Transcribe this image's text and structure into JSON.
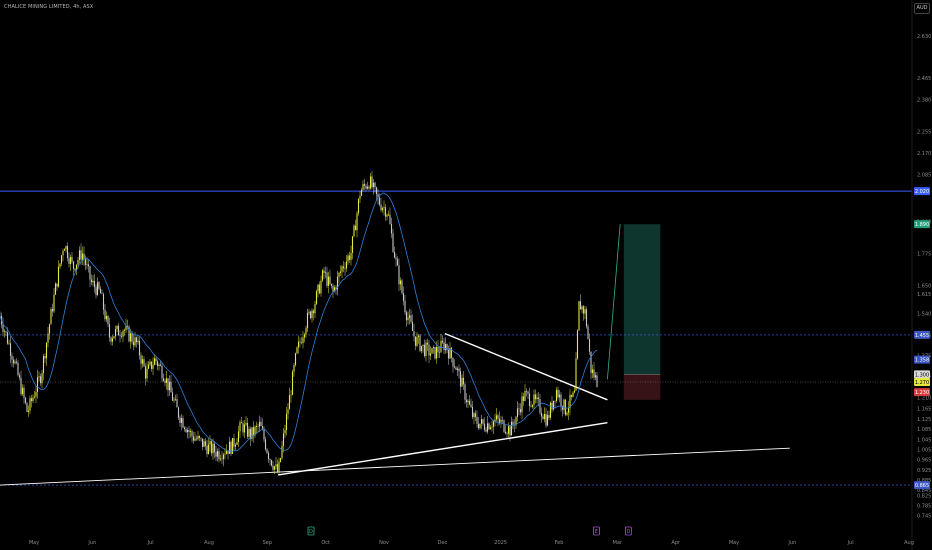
{
  "header": {
    "symbol_title": "CHALICE MINING LIMITED, 4h, ASX",
    "currency": "AUD"
  },
  "colors": {
    "background": "#000000",
    "candle_up": "#e6e83a",
    "candle_down": "#c9c9c9",
    "moving_average": "#2f7fd8",
    "resistance_line": "#3a5cff",
    "trendline": "#ffffff",
    "dashed_level": "#3b57c7",
    "target_zone": "#0f3c34",
    "stop_zone": "#3a1417",
    "projection": "#2db28a"
  },
  "chart_data": {
    "type": "candlestick",
    "price_axis": {
      "ylim": [
        0.72,
        2.7
      ],
      "ticks": [
        "2.630",
        "2.465",
        "2.380",
        "2.255",
        "2.170",
        "2.085",
        "1.900",
        "1.775",
        "1.650",
        "1.615",
        "1.540",
        "1.455",
        "1.375",
        "1.295",
        "1.210",
        "1.165",
        "1.125",
        "1.085",
        "1.045",
        "1.005",
        "0.965",
        "0.925",
        "0.885",
        "0.845",
        "0.825",
        "0.785",
        "0.745"
      ]
    },
    "time_axis": {
      "ticks": [
        "May",
        "Jun",
        "Jul",
        "Aug",
        "Sep",
        "Oct",
        "Nov",
        "Dec",
        "2025",
        "Feb",
        "Mar",
        "Apr",
        "May",
        "Jun",
        "Jul",
        "Aug"
      ]
    },
    "price_labels": [
      {
        "text": "2.020",
        "value": 2.02,
        "color": "#3a5cff"
      },
      {
        "text": "1.890",
        "value": 1.89,
        "color": "#1f9e7a"
      },
      {
        "text": "1.455",
        "value": 1.455,
        "color": "#3b57c7"
      },
      {
        "text": "1.358",
        "value": 1.358,
        "color": "#3b57c7"
      },
      {
        "text": "1.300",
        "value": 1.3,
        "color": "#d9d9d9"
      },
      {
        "text": "1.270",
        "value": 1.27,
        "color": "#e6e83a"
      },
      {
        "text": "1.230",
        "value": 1.23,
        "color": "#d9393c"
      },
      {
        "text": "0.865",
        "value": 0.865,
        "color": "#3b57c7"
      }
    ],
    "horizontal_levels": [
      {
        "name": "resistance",
        "value": 2.02,
        "style": "solid"
      },
      {
        "name": "upper-dashed",
        "value": 1.455,
        "style": "dashed"
      },
      {
        "name": "lower-dashed",
        "value": 0.865,
        "style": "dashed"
      },
      {
        "name": "current-price",
        "value": 1.27,
        "style": "dotted"
      }
    ],
    "trendlines": [
      {
        "name": "triangle-upper",
        "x": [
          0.488,
          0.666
        ],
        "y": [
          1.46,
          1.2
        ]
      },
      {
        "name": "triangle-lower",
        "x": [
          0.305,
          0.666
        ],
        "y": [
          0.905,
          1.11
        ]
      },
      {
        "name": "long-support",
        "x": [
          0.0,
          0.866
        ],
        "y": [
          0.865,
          1.01
        ]
      }
    ],
    "position_tool": {
      "x_start": 0.684,
      "x_end": 0.724,
      "entry": 1.3,
      "target": 1.89,
      "stop": 1.2
    },
    "projection": {
      "x": [
        0.666,
        0.68
      ],
      "y": [
        1.28,
        1.89
      ]
    },
    "event_markers": [
      {
        "x": 0.341,
        "label": "D",
        "color": "#2db28a"
      },
      {
        "x": 0.654,
        "label": "E",
        "color": "#b44ad8"
      },
      {
        "x": 0.689,
        "label": "D",
        "color": "#b44ad8"
      }
    ],
    "price_path": [
      {
        "x": 0.0,
        "y": 1.53
      },
      {
        "x": 0.015,
        "y": 1.36
      },
      {
        "x": 0.03,
        "y": 1.15
      },
      {
        "x": 0.045,
        "y": 1.3
      },
      {
        "x": 0.06,
        "y": 1.62
      },
      {
        "x": 0.07,
        "y": 1.82
      },
      {
        "x": 0.08,
        "y": 1.72
      },
      {
        "x": 0.09,
        "y": 1.78
      },
      {
        "x": 0.1,
        "y": 1.66
      },
      {
        "x": 0.11,
        "y": 1.62
      },
      {
        "x": 0.12,
        "y": 1.45
      },
      {
        "x": 0.135,
        "y": 1.48
      },
      {
        "x": 0.15,
        "y": 1.42
      },
      {
        "x": 0.16,
        "y": 1.3
      },
      {
        "x": 0.17,
        "y": 1.36
      },
      {
        "x": 0.18,
        "y": 1.3
      },
      {
        "x": 0.195,
        "y": 1.15
      },
      {
        "x": 0.21,
        "y": 1.06
      },
      {
        "x": 0.225,
        "y": 1.02
      },
      {
        "x": 0.24,
        "y": 0.99
      },
      {
        "x": 0.255,
        "y": 1.02
      },
      {
        "x": 0.265,
        "y": 1.1
      },
      {
        "x": 0.275,
        "y": 1.06
      },
      {
        "x": 0.285,
        "y": 1.1
      },
      {
        "x": 0.295,
        "y": 0.98
      },
      {
        "x": 0.305,
        "y": 0.91
      },
      {
        "x": 0.315,
        "y": 1.15
      },
      {
        "x": 0.325,
        "y": 1.38
      },
      {
        "x": 0.335,
        "y": 1.5
      },
      {
        "x": 0.345,
        "y": 1.58
      },
      {
        "x": 0.355,
        "y": 1.7
      },
      {
        "x": 0.365,
        "y": 1.62
      },
      {
        "x": 0.375,
        "y": 1.72
      },
      {
        "x": 0.385,
        "y": 1.78
      },
      {
        "x": 0.395,
        "y": 2.02
      },
      {
        "x": 0.405,
        "y": 2.06
      },
      {
        "x": 0.415,
        "y": 1.98
      },
      {
        "x": 0.425,
        "y": 1.94
      },
      {
        "x": 0.435,
        "y": 1.72
      },
      {
        "x": 0.445,
        "y": 1.55
      },
      {
        "x": 0.455,
        "y": 1.44
      },
      {
        "x": 0.465,
        "y": 1.4
      },
      {
        "x": 0.475,
        "y": 1.38
      },
      {
        "x": 0.488,
        "y": 1.42
      },
      {
        "x": 0.5,
        "y": 1.33
      },
      {
        "x": 0.51,
        "y": 1.22
      },
      {
        "x": 0.52,
        "y": 1.12
      },
      {
        "x": 0.53,
        "y": 1.1
      },
      {
        "x": 0.545,
        "y": 1.12
      },
      {
        "x": 0.56,
        "y": 1.08
      },
      {
        "x": 0.575,
        "y": 1.22
      },
      {
        "x": 0.59,
        "y": 1.18
      },
      {
        "x": 0.6,
        "y": 1.12
      },
      {
        "x": 0.61,
        "y": 1.24
      },
      {
        "x": 0.62,
        "y": 1.16
      },
      {
        "x": 0.63,
        "y": 1.22
      },
      {
        "x": 0.635,
        "y": 1.58
      },
      {
        "x": 0.642,
        "y": 1.54
      },
      {
        "x": 0.648,
        "y": 1.32
      },
      {
        "x": 0.655,
        "y": 1.27
      }
    ]
  }
}
